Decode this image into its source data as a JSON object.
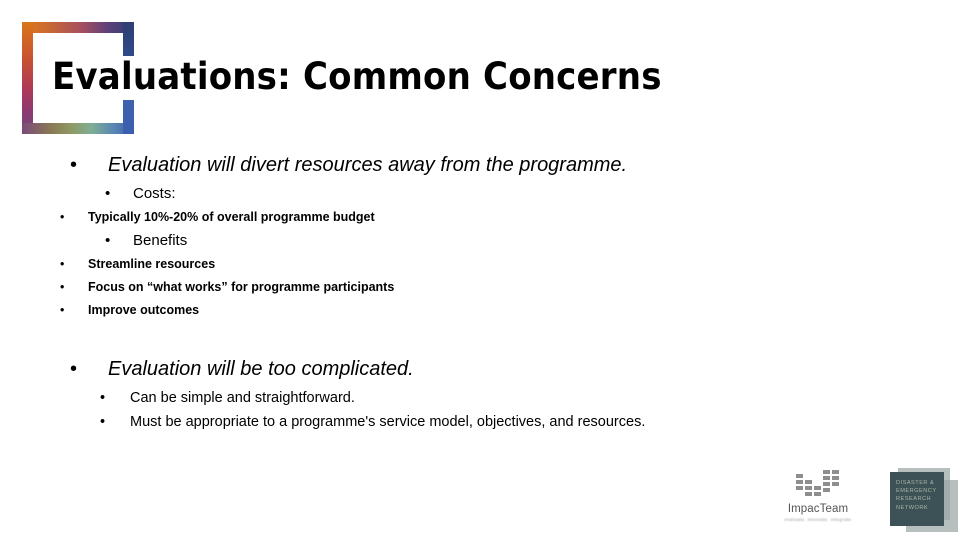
{
  "slide": {
    "title": "Evaluations: Common Concerns",
    "background_color": "#ffffff",
    "text_color": "#000000"
  },
  "decoration": {
    "frame_name": "gradient-corner-frame",
    "gradient_colors": [
      "#d9761a",
      "#c9552e",
      "#b03a55",
      "#8c3a72",
      "#5b3f7a",
      "#2e3f72",
      "#3b5fae",
      "#7fae93",
      "#8f9a63",
      "#8a7a55"
    ]
  },
  "content": {
    "blocks": [
      {
        "heading": "Evaluation will divert resources away from the programme.",
        "groups": [
          {
            "label": "Costs:",
            "items": [
              "Typically 10%-20% of overall programme budget"
            ]
          },
          {
            "label": "Benefits",
            "items": [
              "Streamline resources",
              "Focus on “what works” for programme participants",
              "Improve outcomes"
            ]
          }
        ]
      },
      {
        "heading": "Evaluation will be too complicated.",
        "simple_items": [
          "Can be simple and straightforward.",
          "Must be appropriate to a programme's service model, objectives, and resources."
        ]
      }
    ],
    "bullet_glyph": "•"
  },
  "logos": {
    "impacteam": {
      "name": "ImpacTeam",
      "tagline": "evaluate. innovate. integrate",
      "mark_color": "#8e8e8e"
    },
    "dern": {
      "lines": [
        "Disaster &",
        "Emergency",
        "Research",
        "Network"
      ],
      "square_color": "#3c5257",
      "text_color": "#a9b6a6"
    }
  }
}
